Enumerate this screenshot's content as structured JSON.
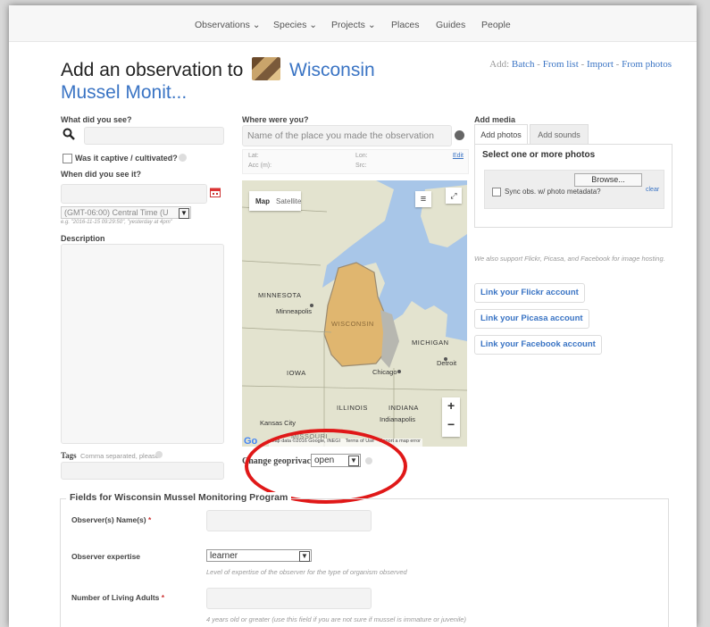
{
  "nav": {
    "items": [
      "Observations ⌄",
      "Species ⌄",
      "Projects ⌄",
      "Places",
      "Guides",
      "People"
    ]
  },
  "header": {
    "title_prefix": "Add an observation to",
    "project_name_line1": "Wisconsin",
    "project_name_line2": "Mussel Monit...",
    "add_prefix": "Add:",
    "add_links": [
      "Batch",
      "From list",
      "Import",
      "From photos"
    ],
    "separator": " - "
  },
  "left": {
    "what_label": "What did you see?",
    "captive_label": "Was it captive / cultivated?",
    "when_label": "When did you see it?",
    "timezone_value": "(GMT-06:00) Central Time (U",
    "date_hint": "e.g. \"2016-11-15 09:29:50\", \"yesterday at 4pm\"",
    "description_label": "Description",
    "tags_label": "Tags",
    "tags_hint": "Comma separated, please"
  },
  "where": {
    "label": "Where were you?",
    "placeholder": "Name of the place you made the observation",
    "lat_label": "Lat:",
    "lon_label": "Lon:",
    "acc_label": "Acc (m):",
    "src_label": "Src:",
    "edit_label": "Edit"
  },
  "map": {
    "map_tab": "Map",
    "satellite_tab": "Satellite",
    "labels": {
      "minnesota": "MINNESOTA",
      "minneapolis": "Minneapolis",
      "wisconsin": "WISCONSIN",
      "michigan": "MICHIGAN",
      "iowa": "IOWA",
      "chicago": "Chicago",
      "detroit": "Detroit",
      "illinois": "ILLINOIS",
      "indiana": "INDIANA",
      "indianapolis": "Indianapolis",
      "kansas_city": "Kansas City",
      "missouri": "MISSOURI"
    },
    "attribution": "Map data ©2016 Google, INEGI",
    "terms": "Terms of Use",
    "report": "Report a map error",
    "zoom_in": "+",
    "zoom_out": "−"
  },
  "geoprivacy": {
    "label": "Change geoprivacy",
    "value": "open"
  },
  "media": {
    "label": "Add media",
    "tabs": [
      "Add photos",
      "Add sounds"
    ],
    "select_title": "Select one or more photos",
    "browse_label": "Browse...",
    "sync_label": "Sync obs. w/ photo metadata?",
    "clear_label": "clear",
    "support_text": "We also support Flickr, Picasa, and Facebook for image hosting.",
    "link_buttons": [
      "Link your Flickr account",
      "Link your Picasa account",
      "Link your Facebook account"
    ]
  },
  "fields": {
    "legend": "Fields for Wisconsin Mussel Monitoring Program",
    "observer_label": "Observer(s) Name(s)",
    "expertise_label": "Observer expertise",
    "expertise_value": "learner",
    "expertise_help": "Level of expertise of the observer for the type of organism observed",
    "adults_label": "Number of Living Adults",
    "adults_help": "4 years old or greater (use this field if you are not sure if mussel is immature or juvenile)",
    "required_mark": "*"
  },
  "colors": {
    "link": "#3a74c4",
    "highlight_ring": "#e01818",
    "wisconsin_fill": "#e0b66f"
  }
}
